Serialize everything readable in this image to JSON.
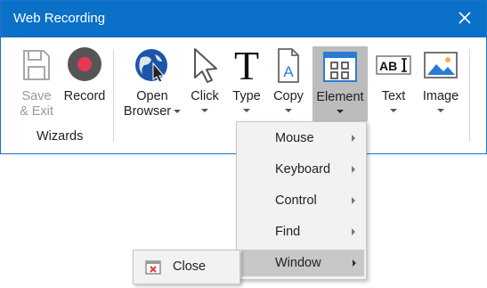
{
  "window": {
    "title": "Web Recording"
  },
  "ribbon": {
    "save_exit_line1": "Save",
    "save_exit_line2": "& Exit",
    "record": "Record",
    "wizards_group": "Wizards",
    "open_browser_line1": "Open",
    "open_browser_line2": "Browser",
    "click": "Click",
    "type": "Type",
    "copy": "Copy",
    "element": "Element",
    "text": "Text",
    "image": "Image"
  },
  "element_menu": {
    "items": [
      {
        "label": "Mouse"
      },
      {
        "label": "Keyboard"
      },
      {
        "label": "Control"
      },
      {
        "label": "Find"
      },
      {
        "label": "Window"
      }
    ]
  },
  "window_submenu": {
    "close": "Close"
  },
  "colors": {
    "titlebar": "#0b70c7",
    "record_dot": "#e8384d",
    "selected_button": "#bcbcbc",
    "menu_background": "#f2f2f2"
  },
  "icons": {
    "save": "floppy-disk-icon",
    "record": "record-icon",
    "open_browser": "globe-cursor-icon",
    "click": "mouse-pointer-icon",
    "type": "letter-t-icon",
    "copy": "document-a-icon",
    "element": "element-grid-icon",
    "text": "abi-text-icon",
    "image": "picture-icon",
    "close_window": "window-close-icon"
  }
}
